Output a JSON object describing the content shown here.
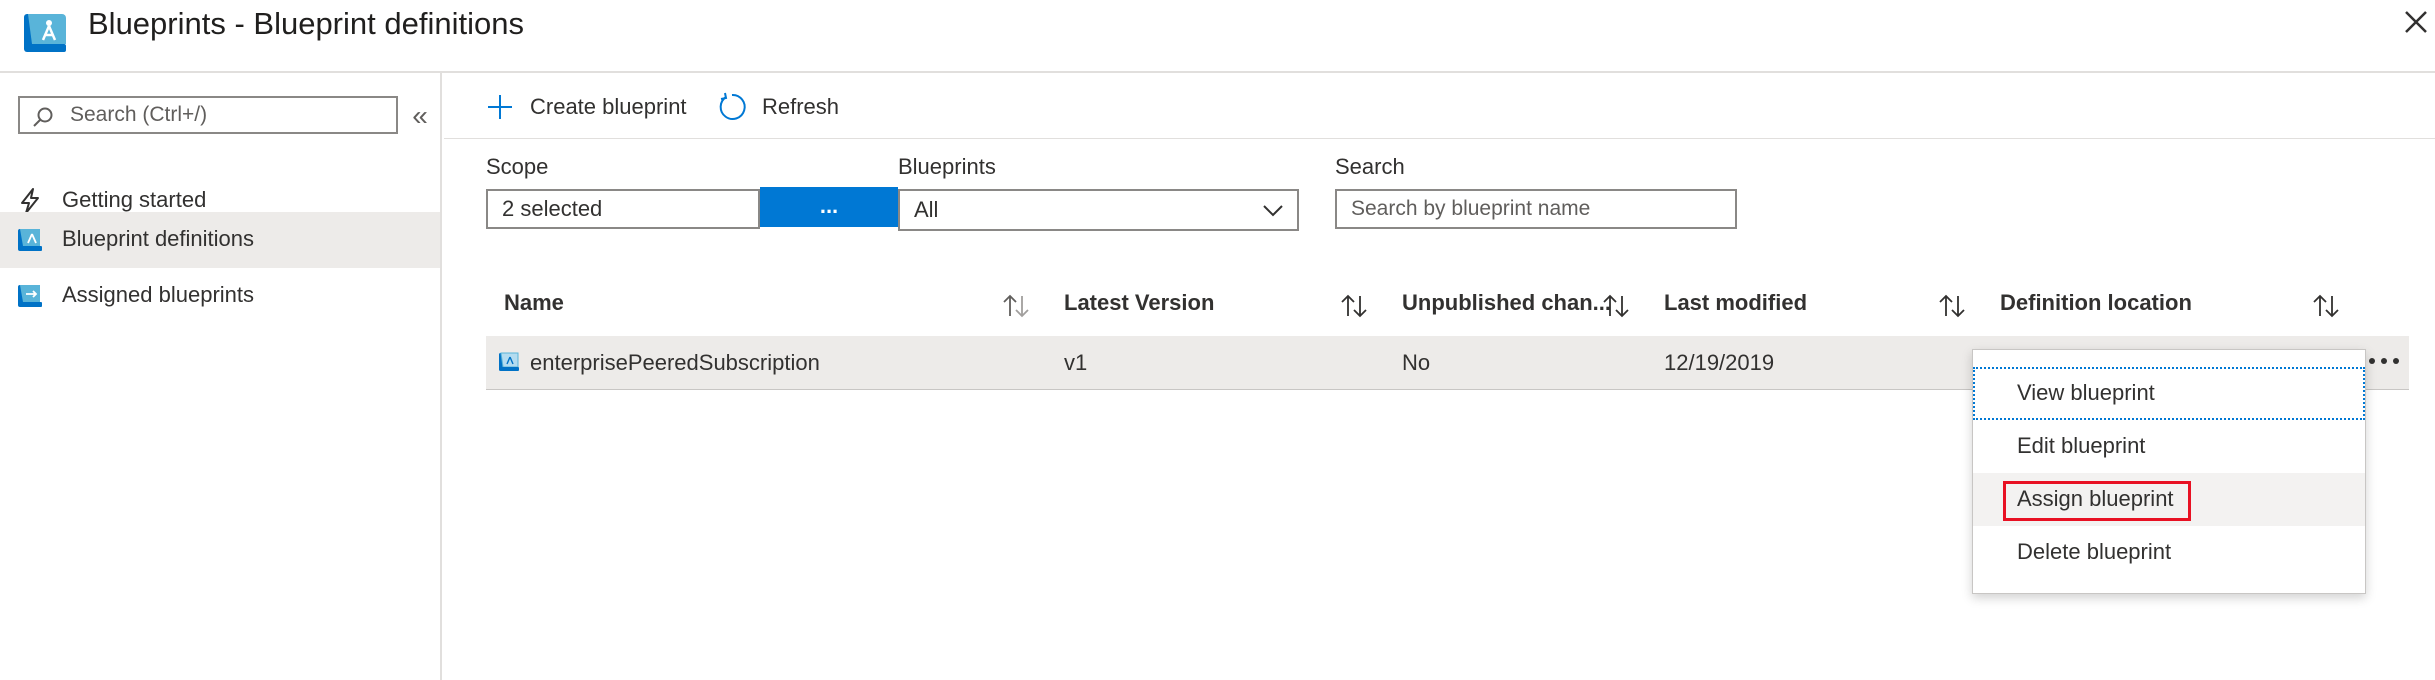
{
  "window": {
    "title": "Blueprints - Blueprint definitions",
    "close_icon": "close-icon"
  },
  "leftnav": {
    "search_placeholder": "Search (Ctrl+/)",
    "collapse_glyph": "«",
    "items": [
      {
        "label": "Getting started",
        "icon": "lightning-icon",
        "active": false
      },
      {
        "label": "Blueprint definitions",
        "icon": "blueprint-definitions-icon",
        "active": true
      },
      {
        "label": "Assigned blueprints",
        "icon": "assigned-blueprints-icon",
        "active": false
      }
    ]
  },
  "toolbar": {
    "create_label": "Create blueprint",
    "refresh_label": "Refresh"
  },
  "filters": {
    "scope_label": "Scope",
    "scope_value": "2 selected",
    "scope_button": "...",
    "blueprints_label": "Blueprints",
    "blueprints_value": "All",
    "search_label": "Search",
    "search_placeholder": "Search by blueprint name"
  },
  "grid": {
    "columns": [
      "Name",
      "Latest Version",
      "Unpublished chan...",
      "Last modified",
      "Definition location"
    ],
    "rows": [
      {
        "name": "enterprisePeeredSubscription",
        "latest_version": "v1",
        "unpublished_changes": "No",
        "last_modified": "12/19/2019",
        "definition_location": ""
      }
    ]
  },
  "context_menu": {
    "items": [
      "View blueprint",
      "Edit blueprint",
      "Assign blueprint",
      "Delete blueprint"
    ],
    "focused_item": "View blueprint",
    "highlighted_item": "Assign blueprint"
  },
  "colors": {
    "accent": "#0078d4",
    "highlight_border": "#e81123",
    "selected_row": "#edebe9"
  }
}
